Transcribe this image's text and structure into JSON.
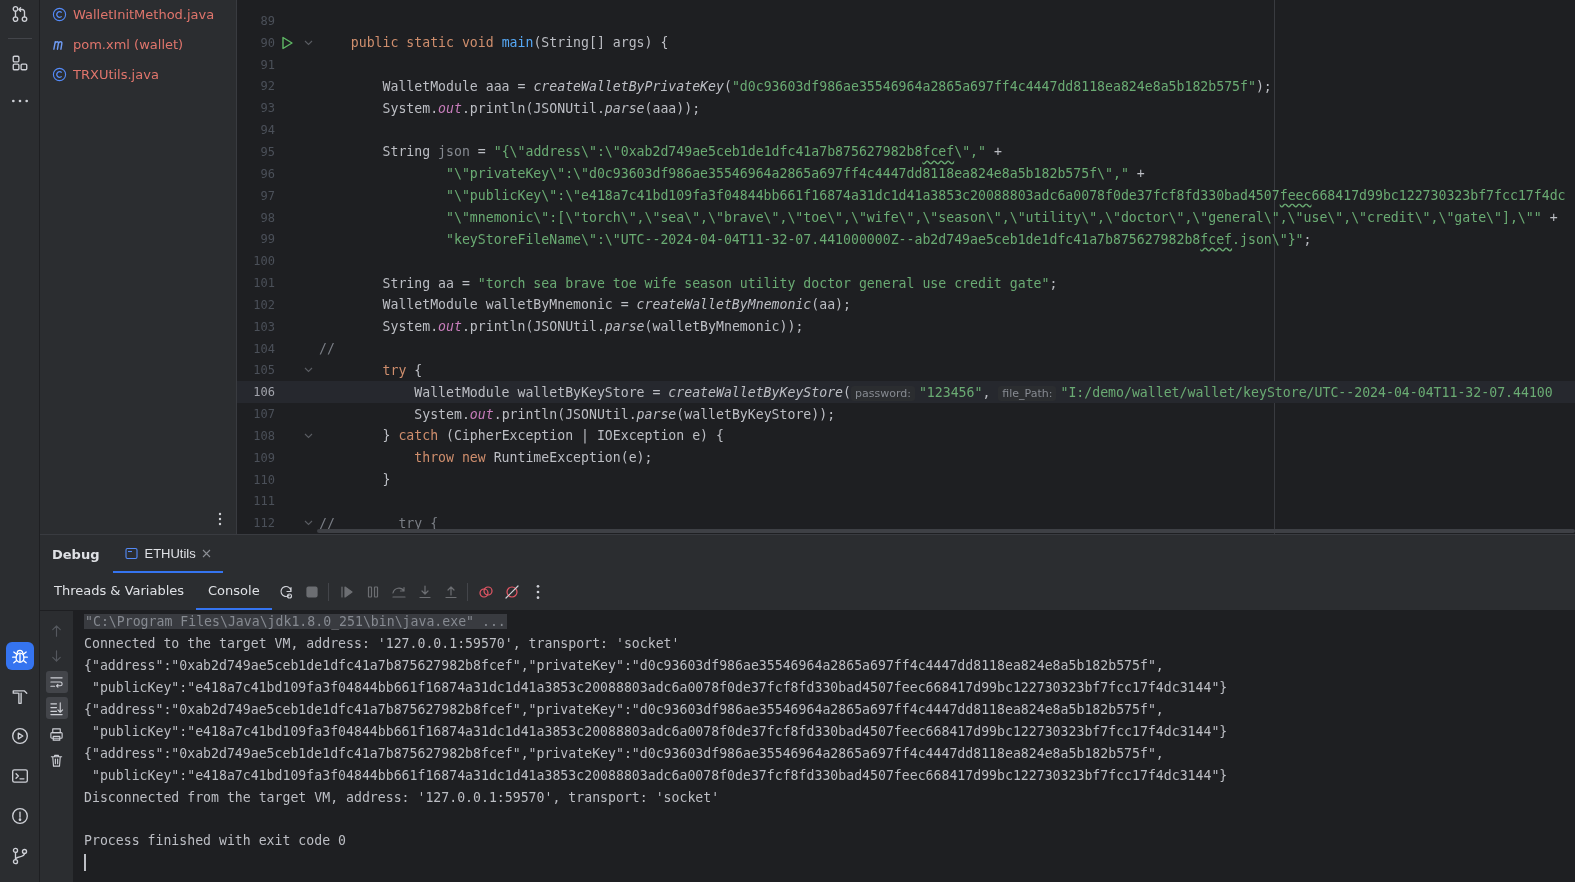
{
  "left_toolbar": {
    "top": [
      {
        "kind": "pull-requests",
        "selected": false
      },
      {
        "kind": "structure",
        "selected": false
      },
      {
        "kind": "more",
        "selected": false
      }
    ],
    "bottom": [
      {
        "kind": "debug",
        "selected": true
      },
      {
        "kind": "build",
        "selected": false
      },
      {
        "kind": "services",
        "selected": false
      },
      {
        "kind": "terminal",
        "selected": false
      },
      {
        "kind": "problems",
        "selected": false
      },
      {
        "kind": "git",
        "selected": false
      }
    ]
  },
  "project": {
    "files": [
      {
        "name": "WalletInitMethod.java",
        "kind": "class"
      },
      {
        "name": "pom.xml (wallet)",
        "kind": "maven"
      },
      {
        "name": "TRXUtils.java",
        "kind": "class"
      }
    ]
  },
  "editor": {
    "lines": [
      {
        "number": "89",
        "run": false,
        "fold": false,
        "current": false
      },
      {
        "number": "90",
        "run": true,
        "fold": true,
        "current": false,
        "tokens": [
          {
            "kind": "keyword",
            "text": "    public static void "
          },
          {
            "kind": "declaration",
            "text": "main"
          },
          {
            "kind": "plain",
            "text": "(String[] args) {"
          }
        ]
      },
      {
        "number": "91",
        "run": false,
        "fold": false,
        "current": false
      },
      {
        "number": "92",
        "run": false,
        "fold": false,
        "current": false,
        "tokens": [
          {
            "kind": "plain",
            "text": "        WalletModule aaa = "
          },
          {
            "kind": "static",
            "text": "createWalletByPrivateKey"
          },
          {
            "kind": "plain",
            "text": "("
          },
          {
            "kind": "string",
            "text": "\"d0c93603df986ae35546964a2865a697ff4c4447dd8118ea824e8a5b182b575f\""
          },
          {
            "kind": "plain",
            "text": ");"
          }
        ]
      },
      {
        "number": "93",
        "run": false,
        "fold": false,
        "current": false,
        "tokens": [
          {
            "kind": "plain",
            "text": "        System."
          },
          {
            "kind": "field",
            "text": "out"
          },
          {
            "kind": "plain",
            "text": ".println(JSONUtil."
          },
          {
            "kind": "static",
            "text": "parse"
          },
          {
            "kind": "plain",
            "text": "(aaa));"
          }
        ]
      },
      {
        "number": "94",
        "run": false,
        "fold": false,
        "current": false
      },
      {
        "number": "95",
        "run": false,
        "fold": false,
        "current": false,
        "tokens": [
          {
            "kind": "plain",
            "text": "        String "
          },
          {
            "kind": "unused",
            "text": "json"
          },
          {
            "kind": "plain",
            "text": " = "
          },
          {
            "kind": "string",
            "text": "\"{\\\"address\\\":\\\"0xab2d749ae5ceb1de1dfc41a7b875627982b8"
          },
          {
            "kind": "typo",
            "text": "fcef"
          },
          {
            "kind": "string",
            "text": "\\\",\""
          },
          {
            "kind": "plain",
            "text": " +"
          }
        ]
      },
      {
        "number": "96",
        "run": false,
        "fold": false,
        "current": false,
        "tokens": [
          {
            "kind": "string",
            "text": "                \"\\\"privateKey\\\":\\\"d0c93603df986ae35546964a2865a697ff4c4447dd8118ea824e8a5b182b575f\\\",\""
          },
          {
            "kind": "plain",
            "text": " +"
          }
        ]
      },
      {
        "number": "97",
        "run": false,
        "fold": false,
        "current": false,
        "tokens": [
          {
            "kind": "string",
            "text": "                \"\\\"publicKey\\\":\\\"e418a7c41bd109fa3f04844bb661f16874a31dc1d41a3853c20088803adc6a0078f0de37fcf8fd330bad4507"
          },
          {
            "kind": "typo",
            "text": "feec"
          },
          {
            "kind": "string",
            "text": "668417d99bc122730323bf7fcc17f4dc"
          }
        ]
      },
      {
        "number": "98",
        "run": false,
        "fold": false,
        "current": false,
        "tokens": [
          {
            "kind": "string",
            "text": "                \"\\\"mnemonic\\\":[\\\"torch\\\",\\\"sea\\\",\\\"brave\\\",\\\"toe\\\",\\\"wife\\\",\\\"season\\\",\\\"utility\\\",\\\"doctor\\\",\\\"general\\\",\\\"use\\\",\\\"credit\\\",\\\"gate\\\"],\\\"\""
          },
          {
            "kind": "plain",
            "text": " +"
          }
        ]
      },
      {
        "number": "99",
        "run": false,
        "fold": false,
        "current": false,
        "tokens": [
          {
            "kind": "string",
            "text": "                \"keyStoreFileName\\\":\\\"UTC--2024-04-04T11-32-07.441000000Z--ab2d749ae5ceb1de1dfc41a7b875627982b8"
          },
          {
            "kind": "typo",
            "text": "fcef"
          },
          {
            "kind": "string",
            "text": ".json\\\"}\""
          },
          {
            "kind": "plain",
            "text": ";"
          }
        ]
      },
      {
        "number": "100",
        "run": false,
        "fold": false,
        "current": false
      },
      {
        "number": "101",
        "run": false,
        "fold": false,
        "current": false,
        "tokens": [
          {
            "kind": "plain",
            "text": "        String aa = "
          },
          {
            "kind": "string",
            "text": "\"torch sea brave toe wife season utility doctor general use credit gate\""
          },
          {
            "kind": "plain",
            "text": ";"
          }
        ]
      },
      {
        "number": "102",
        "run": false,
        "fold": false,
        "current": false,
        "tokens": [
          {
            "kind": "plain",
            "text": "        WalletModule walletByMnemonic = "
          },
          {
            "kind": "static",
            "text": "createWalletByMnemonic"
          },
          {
            "kind": "plain",
            "text": "(aa);"
          }
        ]
      },
      {
        "number": "103",
        "run": false,
        "fold": false,
        "current": false,
        "tokens": [
          {
            "kind": "plain",
            "text": "        System."
          },
          {
            "kind": "field",
            "text": "out"
          },
          {
            "kind": "plain",
            "text": ".println(JSONUtil."
          },
          {
            "kind": "static",
            "text": "parse"
          },
          {
            "kind": "plain",
            "text": "(walletByMnemonic));"
          }
        ]
      },
      {
        "number": "104",
        "run": false,
        "fold": false,
        "current": false,
        "tokens": [
          {
            "kind": "comment",
            "text": "//"
          }
        ]
      },
      {
        "number": "105",
        "run": false,
        "fold": true,
        "current": false,
        "tokens": [
          {
            "kind": "keyword",
            "text": "        try"
          },
          {
            "kind": "plain",
            "text": " {"
          }
        ]
      },
      {
        "number": "106",
        "run": false,
        "fold": false,
        "current": true,
        "tokens": [
          {
            "kind": "plain",
            "text": "            WalletModule walletByKeyStore = "
          },
          {
            "kind": "static",
            "text": "createWalletByKeyStore"
          },
          {
            "kind": "plain",
            "text": "("
          },
          {
            "kind": "hint",
            "text": "password:"
          },
          {
            "kind": "string",
            "text": "\"123456\""
          },
          {
            "kind": "plain",
            "text": ", "
          },
          {
            "kind": "hint",
            "text": "file_Path:"
          },
          {
            "kind": "string",
            "text": "\"I:/demo/wallet/wallet/keyStore/UTC--2024-04-04T11-32-07.44100"
          }
        ]
      },
      {
        "number": "107",
        "run": false,
        "fold": false,
        "current": false,
        "tokens": [
          {
            "kind": "plain",
            "text": "            System."
          },
          {
            "kind": "field",
            "text": "out"
          },
          {
            "kind": "plain",
            "text": ".println(JSONUtil."
          },
          {
            "kind": "static",
            "text": "parse"
          },
          {
            "kind": "plain",
            "text": "(walletByKeyStore));"
          }
        ]
      },
      {
        "number": "108",
        "run": false,
        "fold": true,
        "current": false,
        "tokens": [
          {
            "kind": "plain",
            "text": "        } "
          },
          {
            "kind": "keyword",
            "text": "catch"
          },
          {
            "kind": "plain",
            "text": " (CipherException | IOException e) {"
          }
        ]
      },
      {
        "number": "109",
        "run": false,
        "fold": false,
        "current": false,
        "tokens": [
          {
            "kind": "keyword",
            "text": "            throw new "
          },
          {
            "kind": "plain",
            "text": "RuntimeException(e);"
          }
        ]
      },
      {
        "number": "110",
        "run": false,
        "fold": false,
        "current": false,
        "tokens": [
          {
            "kind": "plain",
            "text": "        }"
          }
        ]
      },
      {
        "number": "111",
        "run": false,
        "fold": false,
        "current": false
      },
      {
        "number": "112",
        "run": false,
        "fold": true,
        "current": false,
        "tokens": [
          {
            "kind": "comment",
            "text": "//        try {"
          }
        ]
      }
    ]
  },
  "debug_panel": {
    "title": "Debug",
    "tabs": [
      {
        "label": "ETHUtils",
        "selected": true
      }
    ],
    "views": [
      {
        "label": "Threads & Variables",
        "selected": false
      },
      {
        "label": "Console",
        "selected": true
      }
    ],
    "toolbar": [
      {
        "kind": "rerun",
        "disabled": false
      },
      {
        "kind": "stop",
        "disabled": true
      },
      {
        "kind": "separator"
      },
      {
        "kind": "resume",
        "disabled": true
      },
      {
        "kind": "pause",
        "disabled": true
      },
      {
        "kind": "step-over",
        "disabled": true
      },
      {
        "kind": "step-into",
        "disabled": true
      },
      {
        "kind": "step-out",
        "disabled": true
      },
      {
        "kind": "separator"
      },
      {
        "kind": "breakpoints",
        "disabled": false
      },
      {
        "kind": "mute",
        "disabled": false
      },
      {
        "kind": "more-vertical",
        "disabled": false
      }
    ],
    "console_tools": [
      {
        "kind": "up",
        "disabled": true,
        "on": false
      },
      {
        "kind": "down",
        "disabled": true,
        "on": false
      },
      {
        "kind": "wrap",
        "disabled": false,
        "on": true
      },
      {
        "kind": "scroll-end",
        "disabled": false,
        "on": true
      },
      {
        "kind": "print",
        "disabled": false,
        "on": false
      },
      {
        "kind": "trash",
        "disabled": false,
        "on": false
      }
    ],
    "console": [
      {
        "kind": "command",
        "text": "\"C:\\Program Files\\Java\\jdk1.8.0_251\\bin\\java.exe\" ..."
      },
      {
        "kind": "output",
        "text": "Connected to the target VM, address: '127.0.0.1:59570', transport: 'socket'"
      },
      {
        "kind": "output",
        "text": "{\"address\":\"0xab2d749ae5ceb1de1dfc41a7b875627982b8fcef\",\"privateKey\":\"d0c93603df986ae35546964a2865a697ff4c4447dd8118ea824e8a5b182b575f\","
      },
      {
        "kind": "output",
        "text": " \"publicKey\":\"e418a7c41bd109fa3f04844bb661f16874a31dc1d41a3853c20088803adc6a0078f0de37fcf8fd330bad4507feec668417d99bc122730323bf7fcc17f4dc3144\"}"
      },
      {
        "kind": "output",
        "text": "{\"address\":\"0xab2d749ae5ceb1de1dfc41a7b875627982b8fcef\",\"privateKey\":\"d0c93603df986ae35546964a2865a697ff4c4447dd8118ea824e8a5b182b575f\","
      },
      {
        "kind": "output",
        "text": " \"publicKey\":\"e418a7c41bd109fa3f04844bb661f16874a31dc1d41a3853c20088803adc6a0078f0de37fcf8fd330bad4507feec668417d99bc122730323bf7fcc17f4dc3144\"}"
      },
      {
        "kind": "output",
        "text": "{\"address\":\"0xab2d749ae5ceb1de1dfc41a7b875627982b8fcef\",\"privateKey\":\"d0c93603df986ae35546964a2865a697ff4c4447dd8118ea824e8a5b182b575f\","
      },
      {
        "kind": "output",
        "text": " \"publicKey\":\"e418a7c41bd109fa3f04844bb661f16874a31dc1d41a3853c20088803adc6a0078f0de37fcf8fd330bad4507feec668417d99bc122730323bf7fcc17f4dc3144\"}"
      },
      {
        "kind": "output",
        "text": "Disconnected from the target VM, address: '127.0.0.1:59570', transport: 'socket'"
      },
      {
        "kind": "blank"
      },
      {
        "kind": "output",
        "text": "Process finished with exit code 0"
      },
      {
        "kind": "cursor"
      }
    ]
  }
}
